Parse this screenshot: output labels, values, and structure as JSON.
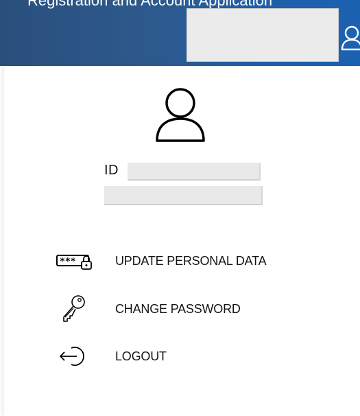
{
  "header": {
    "truncated_title": "Registration and Account Application",
    "search_value": ""
  },
  "profile": {
    "id_label": "ID",
    "id_value": "",
    "name_value": ""
  },
  "menu": {
    "items": [
      {
        "label": "UPDATE PERSONAL DATA",
        "icon": "password-card-icon"
      },
      {
        "label": "CHANGE PASSWORD",
        "icon": "key-icon"
      },
      {
        "label": "LOGOUT",
        "icon": "logout-icon"
      }
    ]
  },
  "colors": {
    "header_start": "#2a4f7c",
    "header_end": "#1c62b2",
    "field_bg": "#e9e9e9",
    "text": "#151515"
  }
}
